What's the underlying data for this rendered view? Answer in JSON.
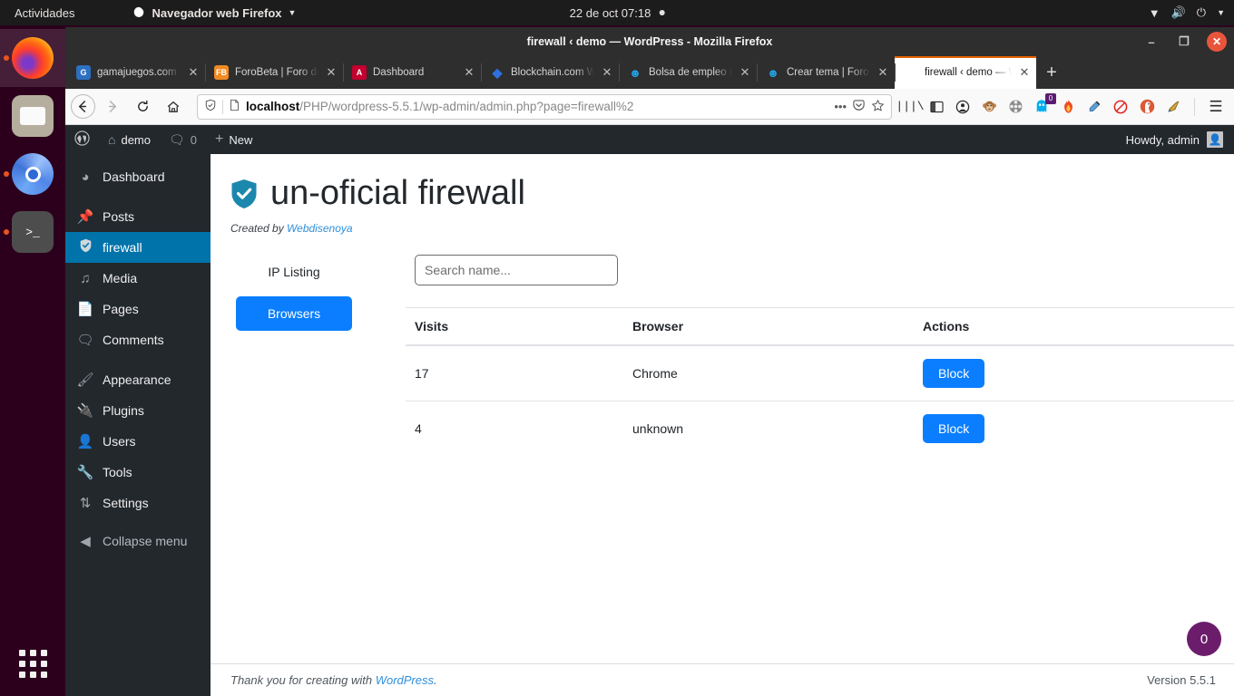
{
  "desktop": {
    "activities": "Actividades",
    "app_menu": "Navegador web Firefox",
    "clock": "22 de oct  07:18",
    "tray": {
      "wifi": "wifi-icon",
      "volume": "volume-icon",
      "power": "power-icon",
      "caret": "chevron-down-icon"
    },
    "dock": [
      {
        "name": "firefox",
        "label": "Firefox",
        "running": true,
        "active": true
      },
      {
        "name": "files",
        "label": "Files",
        "running": false,
        "active": false
      },
      {
        "name": "chromium",
        "label": "Chromium",
        "running": true,
        "active": false
      },
      {
        "name": "terminal",
        "label": "Terminal",
        "running": true,
        "active": false
      }
    ],
    "show_apps": "show-applications"
  },
  "window": {
    "title": "firewall ‹ demo — WordPress - Mozilla Firefox",
    "minimize": "–",
    "maximize": "❐",
    "close": "✕"
  },
  "tabs": [
    {
      "title": "gamajuegos.com -",
      "favicon": "gamajuegos",
      "active": false,
      "close": "✕"
    },
    {
      "title": "ForoBeta | Foro de",
      "favicon": "forobeta",
      "active": false,
      "close": "✕"
    },
    {
      "title": "Dashboard",
      "favicon": "angular",
      "active": false,
      "close": "✕"
    },
    {
      "title": "Blockchain.com W",
      "favicon": "blockchain",
      "active": false,
      "close": "✕"
    },
    {
      "title": "Bolsa de empleo |",
      "favicon": "forobeta2",
      "active": false,
      "close": "✕"
    },
    {
      "title": "Crear tema | Foro",
      "favicon": "forobeta2",
      "active": false,
      "close": "✕"
    },
    {
      "title": "firewall ‹ demo — Wo",
      "favicon": "wordpress",
      "active": true,
      "close": "✕"
    }
  ],
  "newtab_label": "+",
  "navbar": {
    "back": "back-icon",
    "forward": "forward-icon",
    "reload": "reload-icon",
    "home": "home-icon",
    "shield": "shield-icon",
    "page": "page-icon",
    "url_host": "localhost",
    "url_path": "/PHP/wordpress-5.5.1/wp-admin/admin.php?page=firewall%2",
    "ellipsis": "•••",
    "pocket": "pocket-icon",
    "bookmark": "star-icon",
    "extensions": [
      {
        "name": "library-icon",
        "glyph": "❙❙❙\\"
      },
      {
        "name": "sidebar-icon",
        "glyph": "▥"
      },
      {
        "name": "account-icon",
        "glyph": "☻"
      },
      {
        "name": "monkey-extension-icon",
        "glyph": "🐵"
      },
      {
        "name": "film-reel-icon",
        "glyph": "🎞"
      },
      {
        "name": "ghostery-icon",
        "glyph": "👻",
        "badge": "0"
      },
      {
        "name": "flame-icon",
        "glyph": "🔥"
      },
      {
        "name": "colorpicker-icon",
        "glyph": "🖉"
      },
      {
        "name": "adblock-icon",
        "glyph": "🚫"
      },
      {
        "name": "duckduckgo-icon",
        "glyph": "🦆"
      },
      {
        "name": "pencil-highlight-icon",
        "glyph": "✎"
      }
    ],
    "menu": "hamburger-menu-icon"
  },
  "adminbar": {
    "logo": "wordpress-logo-icon",
    "site": "demo",
    "site_icon": "home-icon",
    "comments_icon": "comment-icon",
    "comments_count": "0",
    "new_icon": "+",
    "new_label": "New",
    "howdy": "Howdy, admin",
    "avatar": "avatar"
  },
  "adminmenu": [
    {
      "label": "Dashboard",
      "icon": "dashboard-icon",
      "current": false,
      "gap_after": true
    },
    {
      "label": "Posts",
      "icon": "pin-icon",
      "current": false,
      "gap_after": false
    },
    {
      "label": "firewall",
      "icon": "shield-icon",
      "current": true,
      "gap_after": false
    },
    {
      "label": "Media",
      "icon": "media-icon",
      "current": false,
      "gap_after": false
    },
    {
      "label": "Pages",
      "icon": "pages-icon",
      "current": false,
      "gap_after": false
    },
    {
      "label": "Comments",
      "icon": "comment-icon",
      "current": false,
      "gap_after": true
    },
    {
      "label": "Appearance",
      "icon": "brush-icon",
      "current": false,
      "gap_after": false
    },
    {
      "label": "Plugins",
      "icon": "plug-icon",
      "current": false,
      "gap_after": false
    },
    {
      "label": "Users",
      "icon": "user-icon",
      "current": false,
      "gap_after": false
    },
    {
      "label": "Tools",
      "icon": "wrench-icon",
      "current": false,
      "gap_after": false
    },
    {
      "label": "Settings",
      "icon": "settings-icon",
      "current": false,
      "gap_after": false
    }
  ],
  "collapse_menu": {
    "label": "Collapse menu",
    "icon": "collapse-icon"
  },
  "plugin": {
    "title": "un-oficial firewall",
    "shield_icon": "shield-check-icon",
    "credit_prefix": "Created by ",
    "credit_link": "Webdisenoya",
    "tabs": [
      {
        "label": "IP Listing",
        "active": false
      },
      {
        "label": "Browsers",
        "active": true
      }
    ],
    "search_placeholder": "Search name...",
    "search_value": "",
    "table": {
      "columns": [
        "Visits",
        "Browser",
        "Actions"
      ],
      "rows": [
        {
          "visits": "17",
          "browser": "Chrome",
          "action": "Block"
        },
        {
          "visits": "4",
          "browser": "unknown",
          "action": "Block"
        }
      ]
    }
  },
  "footer": {
    "thanks_prefix": "Thank you for creating with ",
    "thanks_link": "WordPress",
    "thanks_suffix": ".",
    "version": "Version 5.5.1",
    "counter": "0"
  },
  "colors": {
    "wp_admin_dark": "#23282d",
    "wp_current_blue": "#0073aa",
    "button_blue": "#0b7eff",
    "link_blue": "#2f8fdc",
    "counter_purple": "#6b1d6b",
    "firefox_orange": "#e66000"
  }
}
